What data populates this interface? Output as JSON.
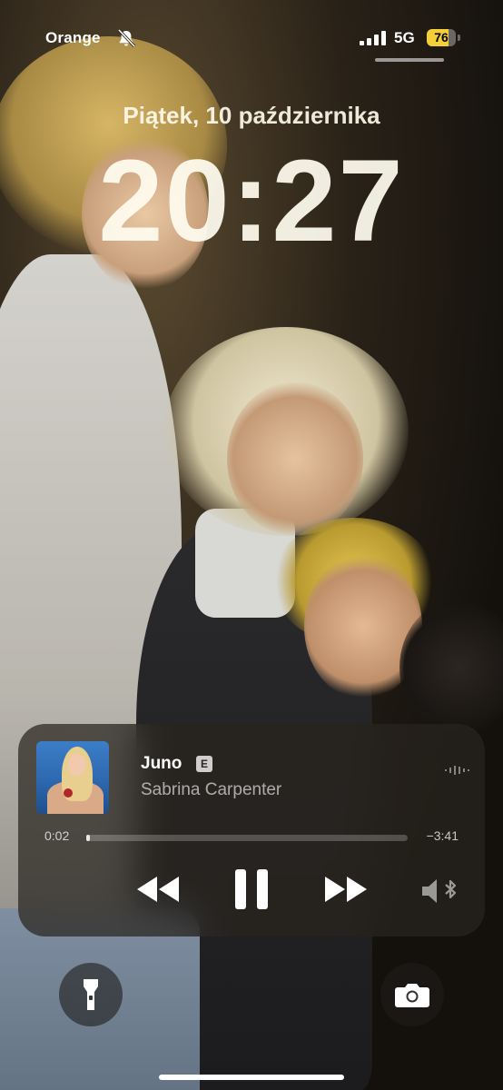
{
  "status_bar": {
    "carrier": "Orange",
    "network": "5G",
    "battery_level": "76",
    "battery_color": "#f4cf38",
    "icons": [
      "bell-slash-icon",
      "signal-bars-icon",
      "battery-icon"
    ]
  },
  "lock_screen": {
    "date": "Piątek, 10 października",
    "time": "20:27"
  },
  "now_playing": {
    "title": "Juno",
    "explicit_badge": "E",
    "artist": "Sabrina Carpenter",
    "elapsed": "0:02",
    "remaining": "−3:41",
    "progress_fraction": 0.009,
    "controls": [
      "rewind-icon",
      "pause-icon",
      "fast-forward-icon",
      "audio-route-icon"
    ]
  },
  "quick_actions": [
    "flashlight-icon",
    "camera-icon"
  ]
}
